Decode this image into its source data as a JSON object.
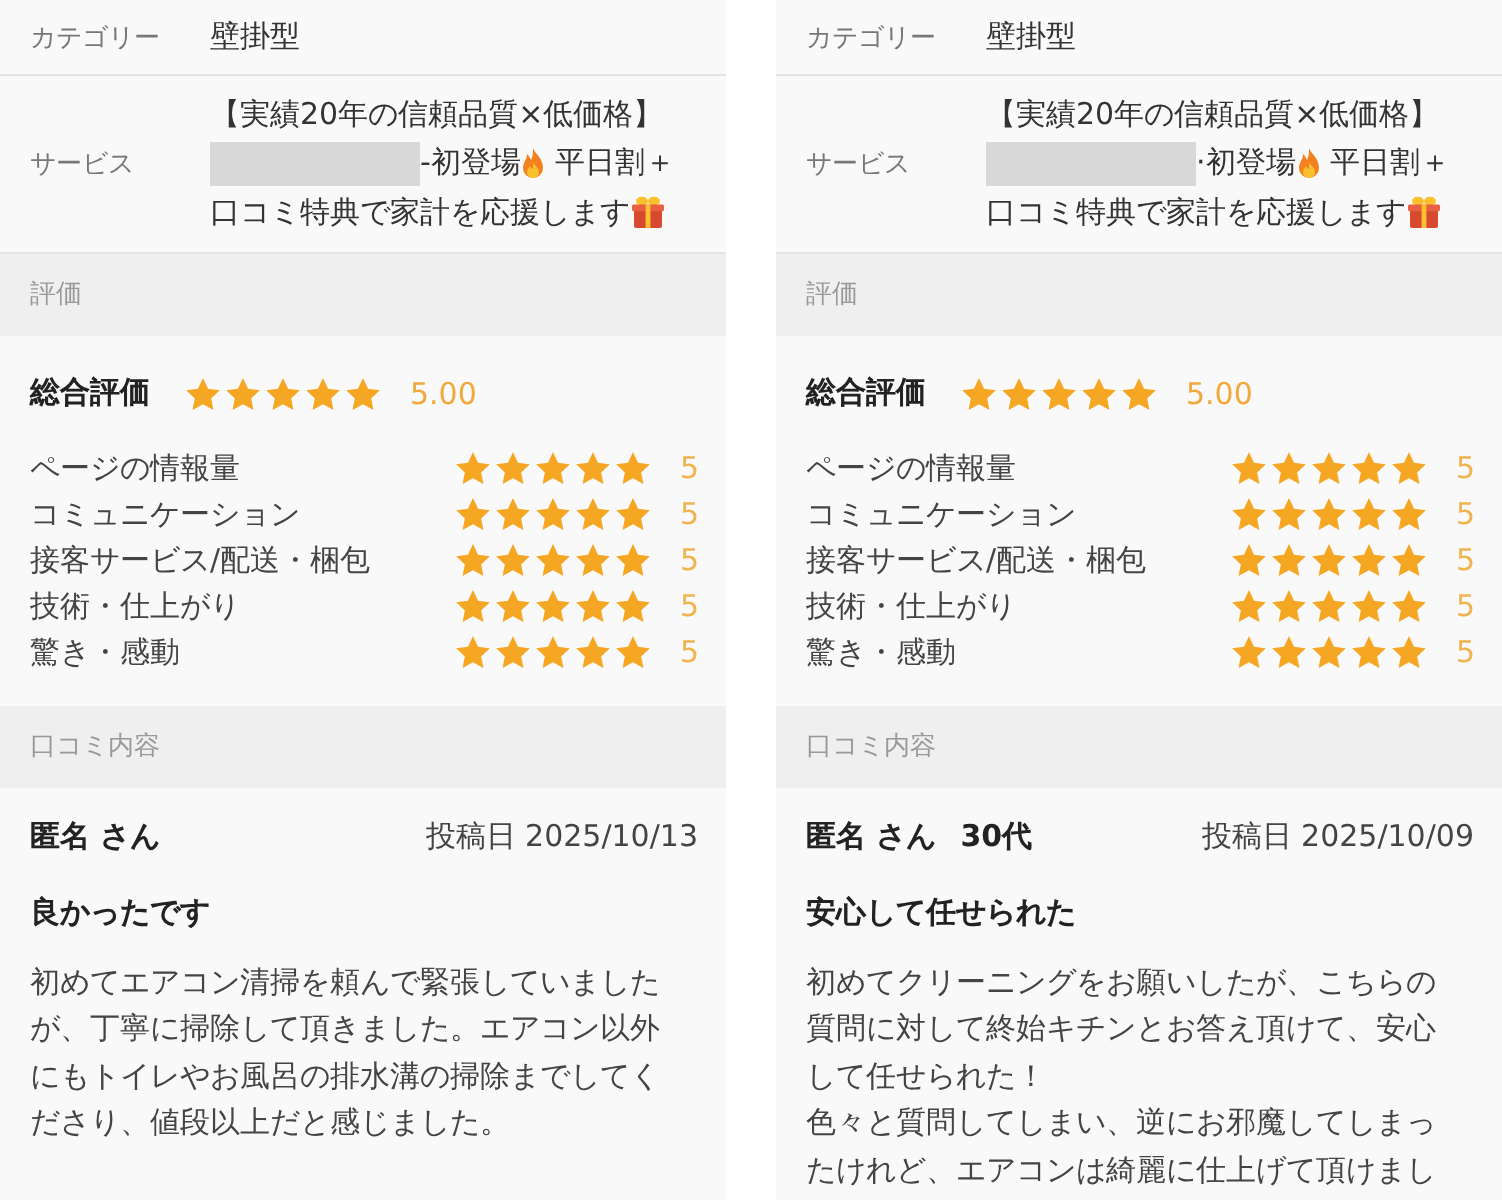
{
  "panels": [
    {
      "category": {
        "label": "カテゴリー",
        "value": "壁掛型"
      },
      "service": {
        "label": "サービス",
        "line_1": "【実績20年の信頼品質×低価格】",
        "redacted": true,
        "line_2_start": "-初登場",
        "line_2_end": "平日割＋",
        "line_3": "口コミ特典で家計を応援します"
      },
      "rating_header": "評価",
      "overall": {
        "label": "総合評価",
        "stars": 5,
        "score": "5.00"
      },
      "criteria": [
        {
          "label": "ページの情報量",
          "stars": 5,
          "score": "5"
        },
        {
          "label": "コミュニケーション",
          "stars": 5,
          "score": "5"
        },
        {
          "label": "接客サービス/配送・梱包",
          "stars": 5,
          "score": "5"
        },
        {
          "label": "技術・仕上がり",
          "stars": 5,
          "score": "5"
        },
        {
          "label": "驚き・感動",
          "stars": 5,
          "score": "5"
        }
      ],
      "reviews_header": "口コミ内容",
      "review": {
        "author": "匿名 さん",
        "date": "投稿日 2025/10/13",
        "title": "良かったです",
        "body": [
          "初めてエアコン清掃を頼んで緊張していましたが、丁寧に掃除して頂きました。エアコン以外にもトイレやお風呂の排水溝の掃除までしてくださり、値段以上だと感じました。"
        ]
      }
    },
    {
      "category": {
        "label": "カテゴリー",
        "value": "壁掛型"
      },
      "service": {
        "label": "サービス",
        "line_1": "【実績20年の信頼品質×低価格】",
        "redacted": true,
        "line_2_start": "·初登場",
        "line_2_end": "平日割＋",
        "line_3": "口コミ特典で家計を応援します"
      },
      "rating_header": "評価",
      "overall": {
        "label": "総合評価",
        "stars": 5,
        "score": "5.00"
      },
      "criteria": [
        {
          "label": "ページの情報量",
          "stars": 5,
          "score": "5"
        },
        {
          "label": "コミュニケーション",
          "stars": 5,
          "score": "5"
        },
        {
          "label": "接客サービス/配送・梱包",
          "stars": 5,
          "score": "5"
        },
        {
          "label": "技術・仕上がり",
          "stars": 5,
          "score": "5"
        },
        {
          "label": "驚き・感動",
          "stars": 5,
          "score": "5"
        }
      ],
      "reviews_header": "口コミ内容",
      "review": {
        "author": "匿名 さん",
        "age": "30代",
        "date": "投稿日 2025/10/09",
        "title": "安心して任せられた",
        "body": [
          "初めてクリーニングをお願いしたが、こちらの質問に対して終始キチンとお答え頂けて、安心して任せられた！",
          "色々と質問してしまい、逆にお邪魔してしまったけれど、エアコンは綺麗に仕上げて頂けまし"
        ]
      }
    }
  ]
}
